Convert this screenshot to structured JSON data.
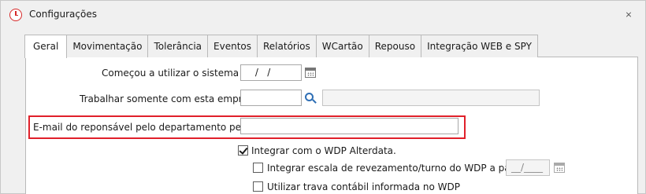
{
  "window": {
    "title": "Configurações",
    "close_glyph": "⨯",
    "title_icon": "clock-icon"
  },
  "tabs": [
    {
      "label": "Geral",
      "active": true
    },
    {
      "label": "Movimentação",
      "active": false
    },
    {
      "label": "Tolerância",
      "active": false
    },
    {
      "label": "Eventos",
      "active": false
    },
    {
      "label": "Relatórios",
      "active": false
    },
    {
      "label": "WCartão",
      "active": false
    },
    {
      "label": "Repouso",
      "active": false
    },
    {
      "label": "Integração WEB e SPY",
      "active": false
    }
  ],
  "form": {
    "start_date": {
      "label": "Começou a utilizar o sistema em:",
      "value": " /   /"
    },
    "company": {
      "label": "Trabalhar somente com esta empresa:",
      "value": "",
      "description": ""
    },
    "email": {
      "label": "E-mail do reponsável pelo departamento pessoal:",
      "value": ""
    },
    "wdp_integration": {
      "label": "Integrar com o WDP Alterdata.",
      "checked": true
    },
    "rotation_scale": {
      "label": "Integrar escala de revezamento/turno do WDP a partir de:",
      "checked": false,
      "date_value": "__/____"
    },
    "accounting_lock": {
      "label": "Utilizar trava contábil informada no WDP",
      "checked": false
    }
  },
  "colors": {
    "highlight": "#e0202a",
    "accent_icon": "#2f6fb5",
    "title_icon": "#d62828"
  }
}
